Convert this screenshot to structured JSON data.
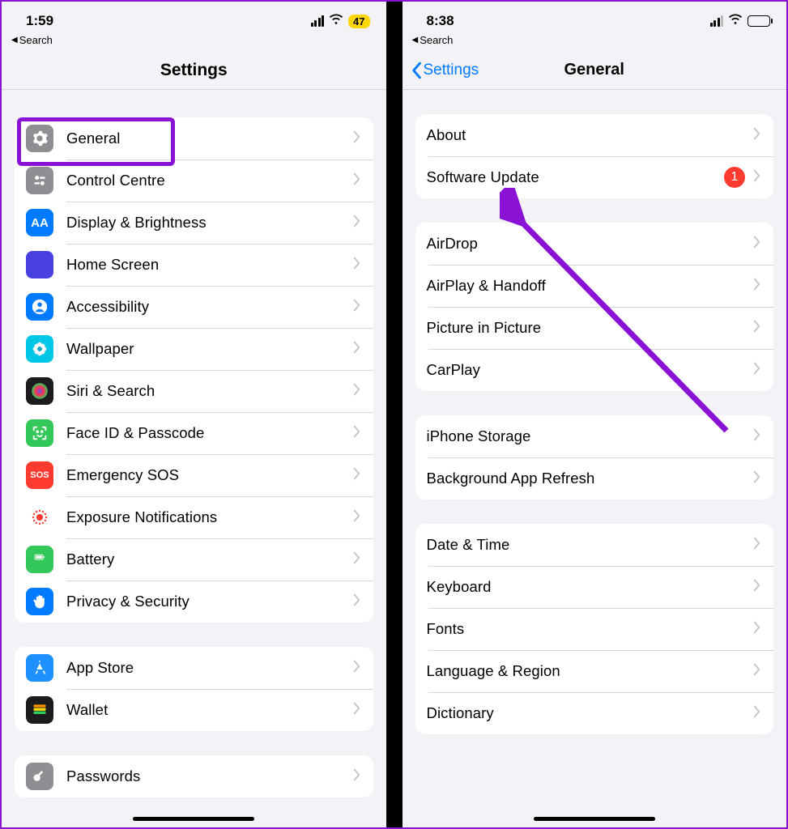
{
  "left": {
    "status": {
      "time": "1:59",
      "battery_badge": "47",
      "breadcrumb": "Search"
    },
    "header": {
      "title": "Settings"
    },
    "group1": [
      {
        "id": "general",
        "label": "General",
        "icon": "gear",
        "bg": "#8e8e93"
      },
      {
        "id": "control-centre",
        "label": "Control Centre",
        "icon": "sliders",
        "bg": "#8e8e93"
      },
      {
        "id": "display",
        "label": "Display & Brightness",
        "icon": "AA",
        "bg": "#007aff"
      },
      {
        "id": "home-screen",
        "label": "Home Screen",
        "icon": "grid",
        "bg": "#4841e0"
      },
      {
        "id": "accessibility",
        "label": "Accessibility",
        "icon": "person",
        "bg": "#007aff"
      },
      {
        "id": "wallpaper",
        "label": "Wallpaper",
        "icon": "flower",
        "bg": "#00c7e6"
      },
      {
        "id": "siri",
        "label": "Siri & Search",
        "icon": "siri",
        "bg": "#1c1c1e"
      },
      {
        "id": "faceid",
        "label": "Face ID & Passcode",
        "icon": "face",
        "bg": "#34c759"
      },
      {
        "id": "sos",
        "label": "Emergency SOS",
        "icon": "SOS",
        "bg": "#ff3b30"
      },
      {
        "id": "exposure",
        "label": "Exposure Notifications",
        "icon": "exposure",
        "bg": "#ffffff"
      },
      {
        "id": "battery",
        "label": "Battery",
        "icon": "battery",
        "bg": "#34c759"
      },
      {
        "id": "privacy",
        "label": "Privacy & Security",
        "icon": "hand",
        "bg": "#007aff"
      }
    ],
    "group2": [
      {
        "id": "appstore",
        "label": "App Store",
        "icon": "appstore",
        "bg": "#1e90ff"
      },
      {
        "id": "wallet",
        "label": "Wallet",
        "icon": "wallet",
        "bg": "#1c1c1e"
      }
    ],
    "group3": [
      {
        "id": "passwords",
        "label": "Passwords",
        "icon": "key",
        "bg": "#8e8e93"
      }
    ]
  },
  "right": {
    "status": {
      "time": "8:38",
      "breadcrumb": "Search"
    },
    "header": {
      "back": "Settings",
      "title": "General"
    },
    "group1": [
      {
        "id": "about",
        "label": "About"
      },
      {
        "id": "software-update",
        "label": "Software Update",
        "badge": "1"
      }
    ],
    "group2": [
      {
        "id": "airdrop",
        "label": "AirDrop"
      },
      {
        "id": "airplay",
        "label": "AirPlay & Handoff"
      },
      {
        "id": "pip",
        "label": "Picture in Picture"
      },
      {
        "id": "carplay",
        "label": "CarPlay"
      }
    ],
    "group3": [
      {
        "id": "storage",
        "label": "iPhone Storage"
      },
      {
        "id": "bgrefresh",
        "label": "Background App Refresh"
      }
    ],
    "group4": [
      {
        "id": "datetime",
        "label": "Date & Time"
      },
      {
        "id": "keyboard",
        "label": "Keyboard"
      },
      {
        "id": "fonts",
        "label": "Fonts"
      },
      {
        "id": "lang",
        "label": "Language & Region"
      },
      {
        "id": "dict",
        "label": "Dictionary"
      }
    ]
  }
}
